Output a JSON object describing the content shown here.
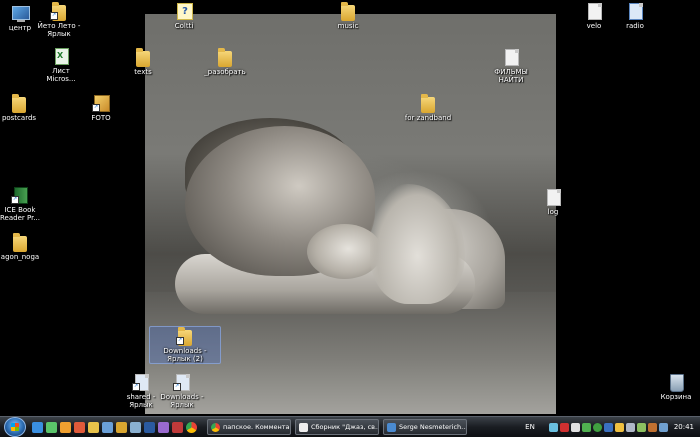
{
  "desktop": {
    "icons": [
      {
        "label": "центр",
        "kind": "monitor"
      },
      {
        "label": "Йето Лето -\nЯрлык",
        "kind": "folder-shortcut"
      },
      {
        "label": "Coltti",
        "kind": "help"
      },
      {
        "label": "music",
        "kind": "folder"
      },
      {
        "label": "velo",
        "kind": "doc"
      },
      {
        "label": "radio",
        "kind": "doc-blue"
      },
      {
        "label": "Лист\nMicros...",
        "kind": "xls"
      },
      {
        "label": "texts",
        "kind": "folder"
      },
      {
        "label": "_разобрать",
        "kind": "folder"
      },
      {
        "label": "ФИЛЬМЫ\nНАЙТИ",
        "kind": "doc"
      },
      {
        "label": "postcards",
        "kind": "folder"
      },
      {
        "label": "FOTO",
        "kind": "photo-shortcut"
      },
      {
        "label": "for zandband",
        "kind": "folder"
      },
      {
        "label": "log",
        "kind": "doc"
      },
      {
        "label": "ICE Book\nReader Pr...",
        "kind": "book"
      },
      {
        "label": "agon_noga",
        "kind": "folder"
      },
      {
        "label": "Downloads -\nЯрлык (2)",
        "kind": "folder-shortcut"
      },
      {
        "label": "shared -\nЯрлык",
        "kind": "doc-shortcut"
      },
      {
        "label": "Downloads -\nЯрлык",
        "kind": "doc-shortcut"
      },
      {
        "label": "Корзина",
        "kind": "bin"
      }
    ]
  },
  "taskbar": {
    "quick_launch": [
      "ie-icon",
      "browser-icon",
      "messenger-icon",
      "media-icon",
      "explorer-icon",
      "mail-icon",
      "folder-icon",
      "window-icon",
      "photoshop-icon",
      "audio-icon",
      "video-icon",
      "chrome-icon"
    ],
    "tasks": [
      {
        "label": "папское. Коммента...",
        "icon": "chrome-icon",
        "color": "#e8453c"
      },
      {
        "label": "Сборник \"Джаз, св...",
        "icon": "player-icon",
        "color": "#f0f0f0"
      },
      {
        "label": "Serge Nesmeterich...",
        "icon": "window-icon",
        "color": "#4a8ad0"
      }
    ],
    "language": "EN",
    "clock": "20:41"
  },
  "colors": {
    "accent": "#2a6ab0",
    "folder": "#e0b040"
  }
}
